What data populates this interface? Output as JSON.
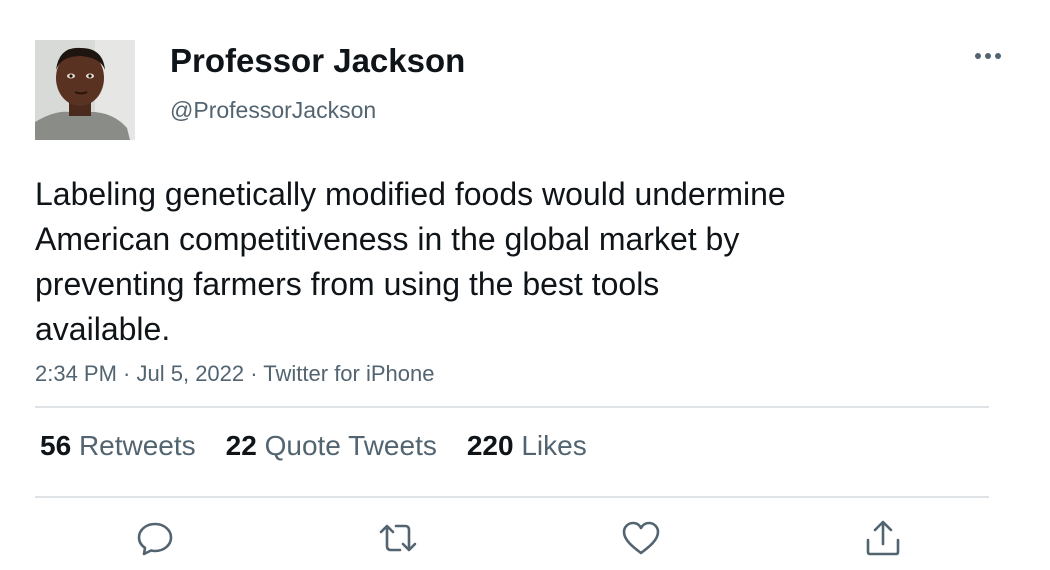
{
  "tweet": {
    "display_name": "Professor Jackson",
    "handle": "@ProfessorJackson",
    "text_lines": [
      "Labeling genetically modified foods would undermine",
      "American competitiveness in the global market by",
      "preventing farmers from using the best tools",
      "available."
    ],
    "time": "2:34 PM",
    "separator": " · ",
    "date": "Jul 5, 2022",
    "source": "Twitter for iPhone"
  },
  "stats": {
    "retweets_count": "56",
    "retweets_label": "Retweets",
    "quotes_count": "22",
    "quotes_label": "Quote Tweets",
    "likes_count": "220",
    "likes_label": "Likes"
  },
  "icons": {
    "more": "more-horizontal-icon",
    "reply": "reply-icon",
    "retweet": "retweet-icon",
    "like": "heart-icon",
    "share": "share-icon"
  },
  "colors": {
    "text": "#0f1419",
    "secondary": "#536471",
    "divider": "#dfe3e6"
  }
}
